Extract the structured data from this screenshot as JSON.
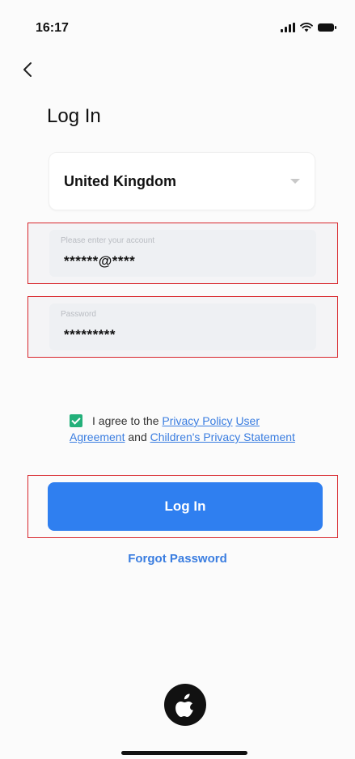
{
  "status_bar": {
    "time": "16:17"
  },
  "header": {
    "title": "Log In"
  },
  "region": {
    "selected": "United Kingdom"
  },
  "account_field": {
    "label": "Please enter your account",
    "value": "******@****"
  },
  "password_field": {
    "label": "Password",
    "value": "*********"
  },
  "agreement": {
    "checked": true,
    "prefix": "I agree to the",
    "privacy_policy": "Privacy Policy",
    "user_agreement": "User Agreement",
    "and": "and",
    "childrens_privacy": "Children's Privacy Statement"
  },
  "login_button": {
    "label": "Log In"
  },
  "forgot_password": {
    "label": "Forgot Password"
  },
  "icons": {
    "back": "chevron-left-icon",
    "dropdown": "chevron-down-icon",
    "checkbox": "checkbox-checked-icon",
    "apple": "apple-icon",
    "signal": "signal-icon",
    "wifi": "wifi-icon",
    "battery": "battery-icon"
  },
  "colors": {
    "primary": "#2f7ff0",
    "link": "#3a7de0",
    "checkbox": "#23b07a",
    "highlight_border": "#d8262c"
  }
}
